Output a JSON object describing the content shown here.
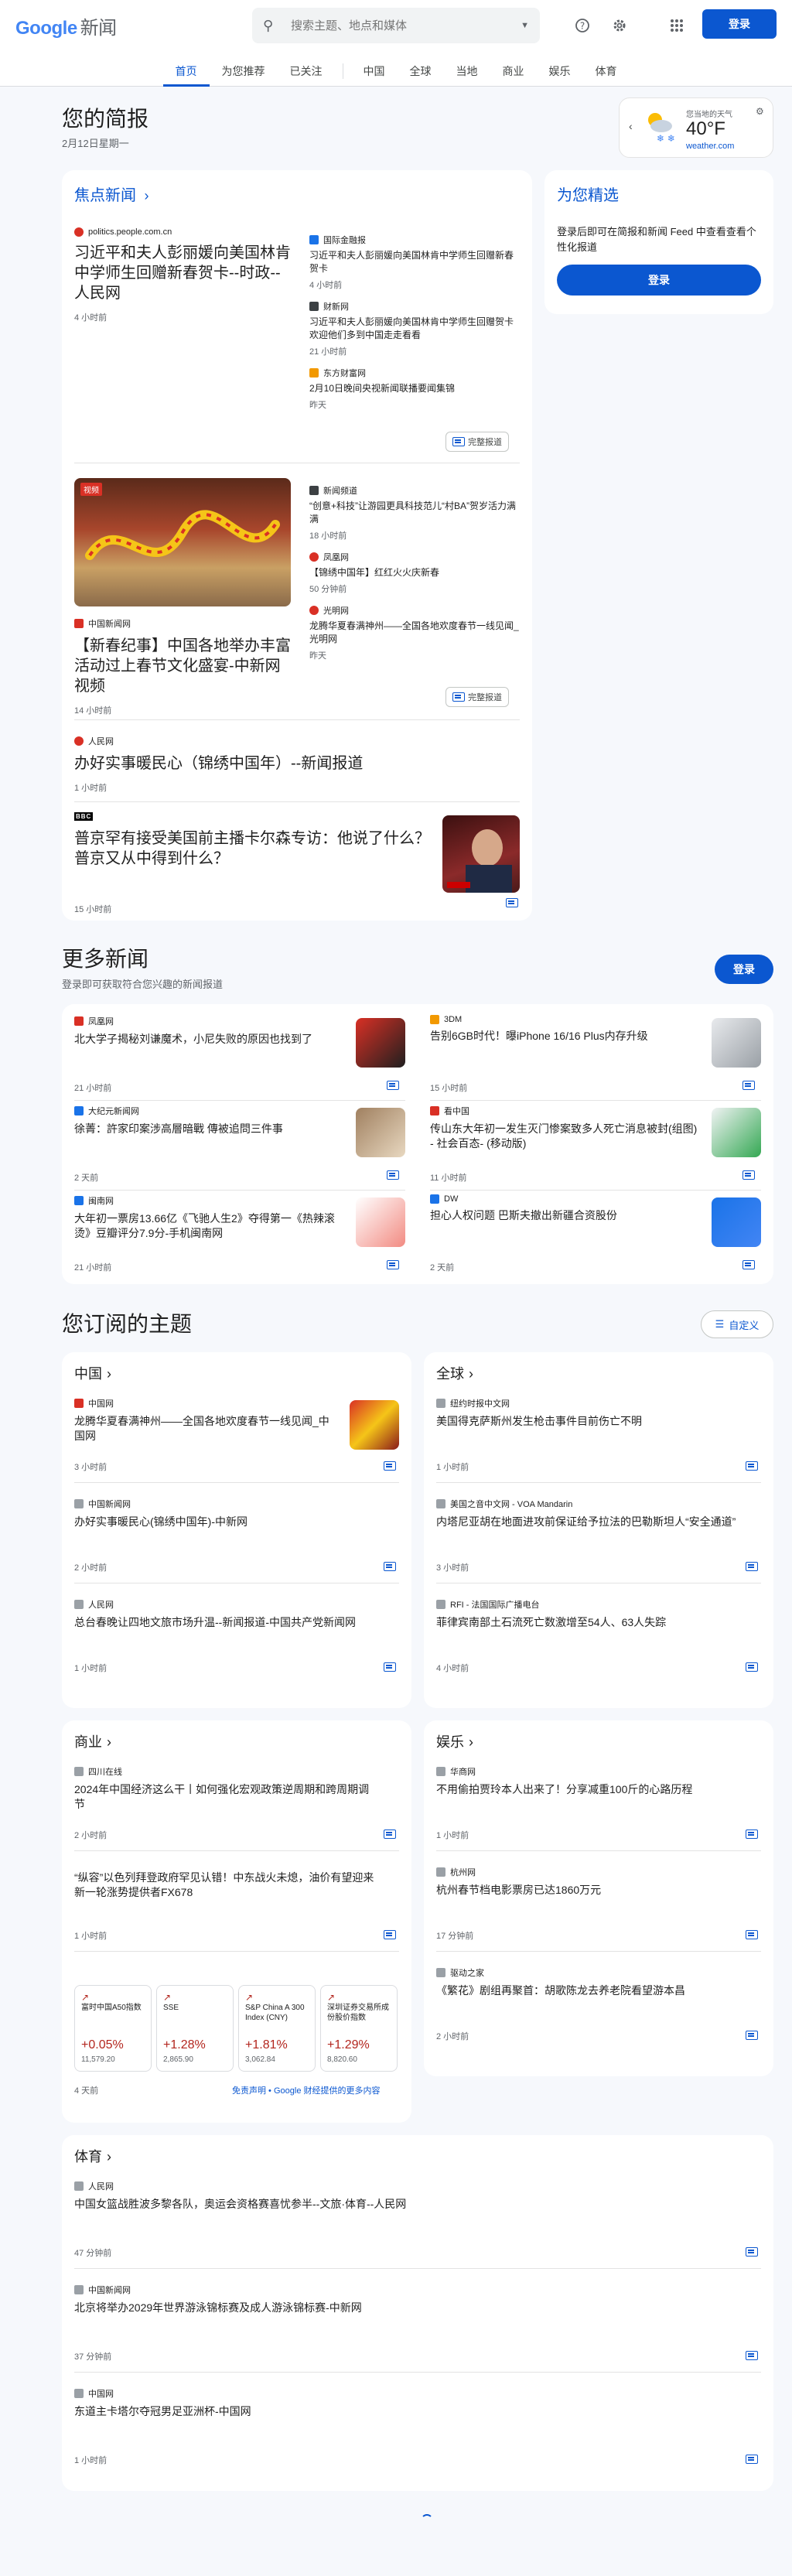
{
  "header": {
    "logo_google": "Google",
    "logo_news": "新闻",
    "search_placeholder": "搜索主题、地点和媒体",
    "login_label": "登录"
  },
  "nav": {
    "tabs": [
      "首页",
      "为您推荐",
      "已关注",
      "中国",
      "全球",
      "当地",
      "商业",
      "娱乐",
      "体育"
    ]
  },
  "briefing": {
    "title": "您的简报",
    "date": "2月12日星期一"
  },
  "weather": {
    "location": "您当地的天气",
    "temp": "40°F",
    "source": "weather.com"
  },
  "top_stories": {
    "title": "焦点新闻",
    "full_coverage": "完整报道",
    "cluster1": {
      "main": {
        "source": "politics.people.com.cn",
        "headline": "习近平和夫人彭丽媛向美国林肯中学师生回赠新春贺卡--时政--人民网",
        "time": "4 小时前"
      },
      "side": [
        {
          "source": "国际金融报",
          "headline": "习近平和夫人彭丽媛向美国林肯中学师生回赠新春贺卡",
          "time": "4 小时前"
        },
        {
          "source": "财新网",
          "headline": "习近平和夫人彭丽媛向美国林肯中学师生回赠贺卡欢迎他们多到中国走走看看",
          "time": "21 小时前"
        },
        {
          "source": "东方财富网",
          "headline": "2月10日晚间央视新闻联播要闻集锦",
          "time": "昨天"
        }
      ]
    },
    "cluster2": {
      "main": {
        "source": "中国新闻网",
        "headline": "【新春纪事】中国各地举办丰富活动过上春节文化盛宴-中新网视频",
        "time": "14 小时前",
        "badge": "视频"
      },
      "side": [
        {
          "source": "新闻频道",
          "headline": "“创意+科技”让游园更具科技范儿“村BA”贺岁活力满满",
          "time": "18 小时前"
        },
        {
          "source": "凤凰网",
          "headline": "【锦绣中国年】红红火火庆新春",
          "time": "50 分钟前"
        },
        {
          "source": "光明网",
          "headline": "龙腾华夏春满神州——全国各地欢度春节一线见闻_光明网",
          "time": "昨天"
        }
      ]
    },
    "single1": {
      "source": "人民网",
      "headline": "办好实事暖民心（锦绣中国年）--新闻报道",
      "time": "1 小时前"
    },
    "single2": {
      "source": "BBC",
      "headline": "普京罕有接受美国前主播卡尔森专访：他说了什么？普京又从中得到什么？",
      "time": "15 小时前"
    }
  },
  "for_you": {
    "title": "为您精选",
    "text": "登录后即可在简报和新闻 Feed 中查看查看个性化报道",
    "login_label": "登录"
  },
  "more_news": {
    "title": "更多新闻",
    "subtitle": "登录即可获取符合您兴趣的新闻报道",
    "login_label": "登录",
    "items": [
      {
        "source": "凤凰网",
        "headline": "北大学子揭秘刘谦魔术，小尼失败的原因也找到了",
        "time": "21 小时前"
      },
      {
        "source": "3DM",
        "headline": "告别6GB时代！曝iPhone 16/16 Plus内存升级",
        "time": "15 小时前"
      },
      {
        "source": "大纪元新闻网",
        "headline": "徐菁：許家印案涉高層暗戰 傳被追問三件事",
        "time": "2 天前"
      },
      {
        "source": "看中国",
        "headline": "传山东大年初一发生灭门惨案致多人死亡消息被封(组图) - 社会百态- (移动版)",
        "time": "11 小时前"
      },
      {
        "source": "闽南网",
        "headline": "大年初一票房13.66亿《飞驰人生2》夺得第一《热辣滚烫》豆瓣评分7.9分-手机闽南网",
        "time": "21 小时前"
      },
      {
        "source": "DW",
        "headline": "担心人权问题 巴斯夫撤出新疆合资股份",
        "time": "2 天前"
      }
    ]
  },
  "topics": {
    "title": "您订阅的主题",
    "customize_label": "自定义",
    "china": {
      "title": "中国",
      "items": [
        {
          "source": "中国网",
          "headline": "龙腾华夏春满神州——全国各地欢度春节一线见闻_中国网",
          "time": "3 小时前"
        },
        {
          "source": "中国新闻网",
          "headline": "办好实事暖民心(锦绣中国年)-中新网",
          "time": "2 小时前"
        },
        {
          "source": "人民网",
          "headline": "总台春晚让四地文旅市场升温--新闻报道-中国共产党新闻网",
          "time": "1 小时前"
        }
      ]
    },
    "world": {
      "title": "全球",
      "items": [
        {
          "source": "纽约时报中文网",
          "headline": "美国得克萨斯州发生枪击事件目前伤亡不明",
          "time": "1 小时前"
        },
        {
          "source": "美国之音中文网 - VOA Mandarin",
          "headline": "内塔尼亚胡在地面进攻前保证给予拉法的巴勒斯坦人“安全通道”",
          "time": "3 小时前"
        },
        {
          "source": "RFI - 法国国际广播电台",
          "headline": "菲律宾南部土石流死亡数激增至54人、63人失踪",
          "time": "4 小时前"
        }
      ]
    },
    "business": {
      "title": "商业",
      "items": [
        {
          "source": "四川在线",
          "headline": "2024年中国经济这么干丨如何强化宏观政策逆周期和跨周期调节",
          "time": "2 小时前"
        },
        {
          "source": "",
          "headline": "“纵容”以色列拜登政府罕见认错！中东战火未熄，油价有望迎来新一轮涨势提供者FX678",
          "time": "1 小时前"
        }
      ],
      "stocks": [
        {
          "name": "富时中国A50指数",
          "pct": "+0.05%",
          "val": "11,579.20"
        },
        {
          "name": "SSE",
          "pct": "+1.28%",
          "val": "2,865.90"
        },
        {
          "name": "S&P China A 300 Index (CNY)",
          "pct": "+1.81%",
          "val": "3,062.84"
        },
        {
          "name": "深圳证券交易所成份股价指数",
          "pct": "+1.29%",
          "val": "8,820.60"
        }
      ],
      "stocks_time": "4 天前",
      "disclaimer": "免责声明 • Google 财经提供的更多内容"
    },
    "entertainment": {
      "title": "娱乐",
      "items": [
        {
          "source": "华商网",
          "headline": "不用偷拍贾玲本人出来了！分享减重100斤的心路历程",
          "time": "1 小时前"
        },
        {
          "source": "杭州网",
          "headline": "杭州春节档电影票房已达1860万元",
          "time": "17 分钟前"
        },
        {
          "source": "驱动之家",
          "headline": "《繁花》剧组再聚首：胡歌陈龙去养老院看望游本昌",
          "time": "2 小时前"
        }
      ]
    },
    "sports": {
      "title": "体育",
      "items": [
        {
          "source": "人民网",
          "headline": "中国女篮战胜波多黎各队，奥运会资格赛喜忧参半--文旅·体育--人民网",
          "time": "47 分钟前"
        },
        {
          "source": "中国新闻网",
          "headline": "北京将举办2029年世界游泳锦标赛及成人游泳锦标赛-中新网",
          "time": "37 分钟前"
        },
        {
          "source": "中国网",
          "headline": "东道主卡塔尔夺冠男足亚洲杯-中国网",
          "time": "1 小时前"
        }
      ]
    }
  },
  "colors": {
    "accent": "#0b57d0",
    "negative": "#b3261e"
  }
}
